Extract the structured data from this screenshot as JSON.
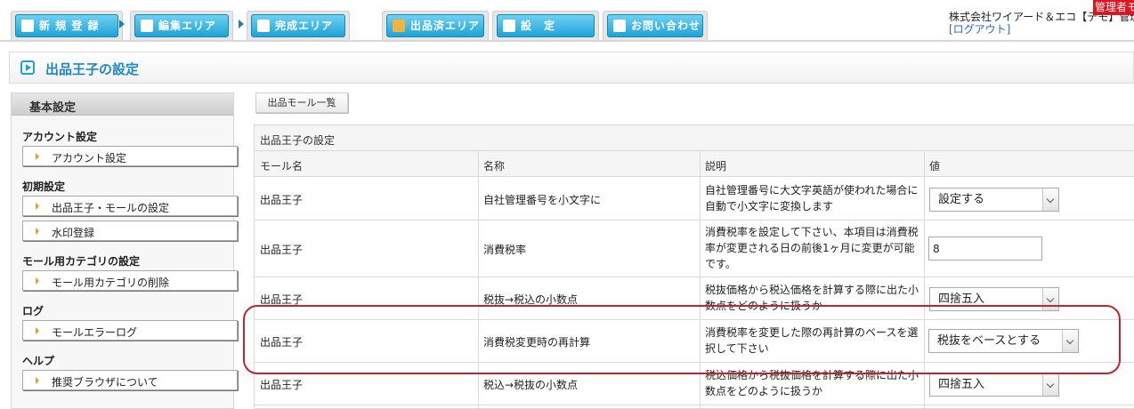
{
  "nav": {
    "tabs": [
      {
        "label": "新 規 登 録",
        "icon": "pencil-icon"
      },
      {
        "label": "編集エリア",
        "icon": "list-icon"
      },
      {
        "label": "完成エリア",
        "icon": "sitemap-icon"
      },
      {
        "label": "出品済エリア",
        "icon": "box-icon"
      },
      {
        "label": "設　定",
        "icon": "gear-icon"
      },
      {
        "label": "お問い合わせ",
        "icon": "chat-icon"
      }
    ],
    "company": "株式会社ワイアード＆エコ【デモ】管理者",
    "logout": "[ログアウト]",
    "admin_badge": "管理者モ"
  },
  "page": {
    "title": "出品王子の設定"
  },
  "sidebar": {
    "heading": "基本設定",
    "groups": [
      {
        "label": "アカウント設定",
        "items": [
          "アカウント設定"
        ]
      },
      {
        "label": "初期設定",
        "items": [
          "出品王子・モールの設定",
          "水印登録"
        ]
      },
      {
        "label": "モール用カテゴリの設定",
        "items": [
          "モール用カテゴリの削除"
        ]
      },
      {
        "label": "ログ",
        "items": [
          "モールエラーログ"
        ]
      },
      {
        "label": "ヘルプ",
        "items": [
          "推奨ブラウザについて"
        ]
      }
    ]
  },
  "main": {
    "mall_list_button": "出品モール一覧",
    "table": {
      "caption": "出品王子の設定",
      "headers": [
        "モール名",
        "名称",
        "説明",
        "値"
      ],
      "rows": [
        {
          "mall": "出品王子",
          "name": "自社管理番号を小文字に",
          "description": "自社管理番号に大文字英語が使われた場合に自動で小文字に変換します",
          "value": "設定する",
          "control": "select"
        },
        {
          "mall": "出品王子",
          "name": "消費税率",
          "description": "消費税率を設定して下さい、本項目は消費税率が変更される日の前後1ヶ月に変更が可能です。",
          "value": "8",
          "control": "text"
        },
        {
          "mall": "出品王子",
          "name": "税抜→税込の小数点",
          "description": "税抜価格から税込価格を計算する際に出た小数点をどのように扱うか",
          "value": "四捨五入",
          "control": "select"
        },
        {
          "mall": "出品王子",
          "name": "消費税変更時の再計算",
          "description": "消費税率を変更した際の再計算のベースを選択して下さい",
          "value": "税抜をベースとする",
          "control": "select"
        },
        {
          "mall": "出品王子",
          "name": "税込→税抜の小数点",
          "description": "税込価格から税抜価格を計算する際に出た小数点をどのように扱うか",
          "value": "四捨五入",
          "control": "select"
        }
      ]
    }
  },
  "colors": {
    "accent": "#1ea3d6",
    "highlight": "#c0262d",
    "badge": "#e0141e"
  }
}
